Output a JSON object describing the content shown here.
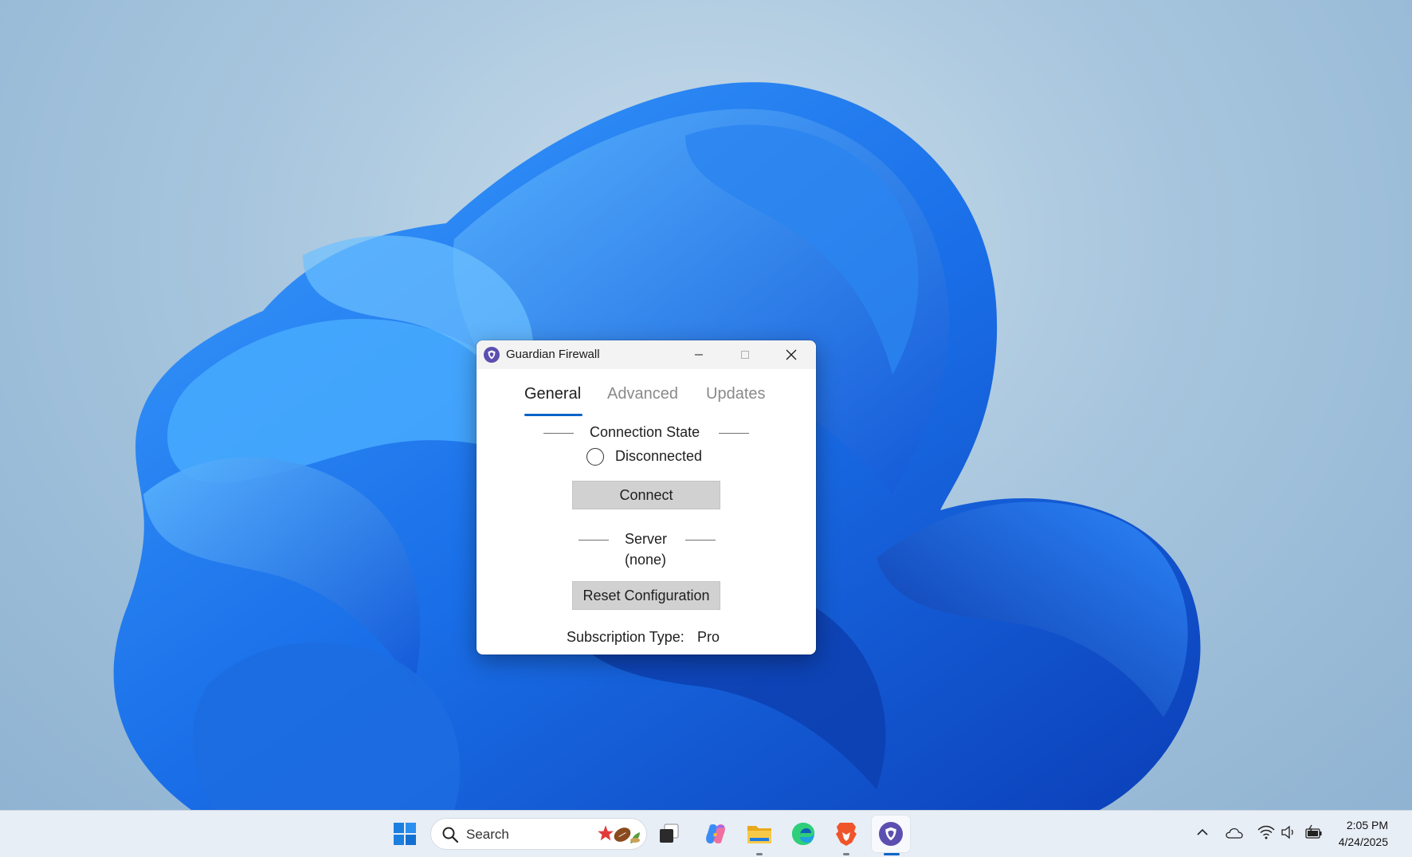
{
  "window": {
    "title": "Guardian Firewall",
    "tabs": [
      {
        "label": "General",
        "active": true
      },
      {
        "label": "Advanced",
        "active": false
      },
      {
        "label": "Updates",
        "active": false
      }
    ],
    "connection_section": {
      "heading": "Connection State",
      "status": "Disconnected",
      "connect_label": "Connect"
    },
    "server_section": {
      "heading": "Server",
      "value": "(none)",
      "reset_label": "Reset Configuration"
    },
    "subscription": {
      "label": "Subscription Type:",
      "value": "Pro"
    }
  },
  "taskbar": {
    "search_label": "Search",
    "pinned": [
      {
        "name": "start-icon"
      },
      {
        "name": "task-view-icon"
      },
      {
        "name": "copilot-icon"
      },
      {
        "name": "file-explorer-icon"
      },
      {
        "name": "edge-icon"
      },
      {
        "name": "brave-icon"
      },
      {
        "name": "guardian-firewall-icon"
      }
    ],
    "clock": {
      "time": "2:05 PM",
      "date": "4/24/2025"
    }
  },
  "colors": {
    "accent": "#0a64c8",
    "app_purple": "#5b4fb0",
    "button_bg": "#d1d1d1"
  }
}
